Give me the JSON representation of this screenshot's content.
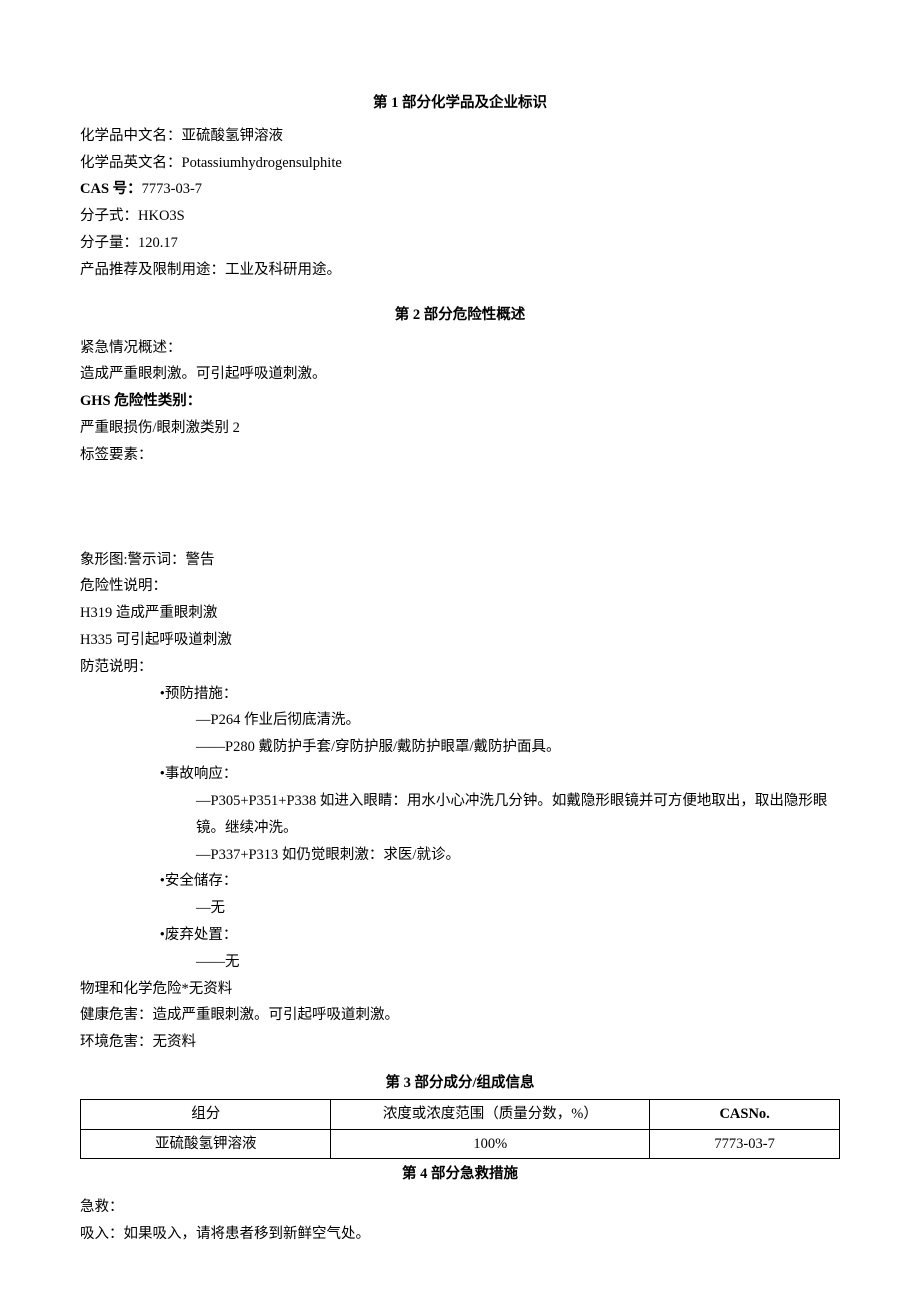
{
  "section1": {
    "title": "第 1 部分化学品及企业标识",
    "chinese_name_label": "化学品中文名：",
    "chinese_name_value": "亚硫酸氢钾溶液",
    "english_name_label": "化学品英文名：",
    "english_name_value": "Potassiumhydrogensulphite",
    "cas_label": "CAS 号：",
    "cas_value": "7773-03-7",
    "formula_label": "分子式：",
    "formula_value": "HKO3S",
    "mw_label": "分子量：",
    "mw_value": "120.17",
    "usage_label": "产品推荐及限制用途：",
    "usage_value": "工业及科研用途。"
  },
  "section2": {
    "title": "第 2 部分危险性概述",
    "emergency_label": "紧急情况概述：",
    "emergency_text": "造成严重眼刺激。可引起呼吸道刺激。",
    "ghs_label": "GHS 危险性类别：",
    "ghs_text": "严重眼损伤/眼刺激类别 2",
    "label_elements": "标签要素：",
    "pictogram_line": "象形图:警示词：警告",
    "hazard_heading": "危险性说明：",
    "h319": "H319 造成严重眼刺激",
    "h335": "H335 可引起呼吸道刺激",
    "precaution_heading": "防范说明：",
    "prevention_heading": "•预防措施：",
    "p264": "—P264 作业后彻底清洗。",
    "p280": "——P280 戴防护手套/穿防护服/戴防护眼罩/戴防护面具。",
    "response_heading": "•事故响应：",
    "p305": "—P305+P351+P338 如进入眼睛：用水小心冲洗几分钟。如戴隐形眼镜并可方便地取出，取出隐形眼镜。继续冲洗。",
    "p337": "—P337+P313 如仍觉眼刺激：求医/就诊。",
    "storage_heading": "•安全储存：",
    "storage_text": "—无",
    "disposal_heading": "•废弃处置：",
    "disposal_text": "——无",
    "phys_line": "物理和化学危险*无资料",
    "health_label": "健康危害：",
    "health_text": "造成严重眼刺激。可引起呼吸道刺激。",
    "env_label": "环境危害：",
    "env_text": "无资料"
  },
  "section3": {
    "title": "第 3 部分成分/组成信息",
    "headers": {
      "c1": "组分",
      "c2": "浓度或浓度范围（质量分数，%）",
      "c3": "CASNo."
    },
    "row": {
      "c1": "亚硫酸氢钾溶液",
      "c2": "100%",
      "c3": "7773-03-7"
    }
  },
  "section4": {
    "title": "第 4 部分急救措施",
    "first_aid_label": "急救：",
    "inhalation_label": "吸入：",
    "inhalation_text": "如果吸入，请将患者移到新鲜空气处。"
  }
}
